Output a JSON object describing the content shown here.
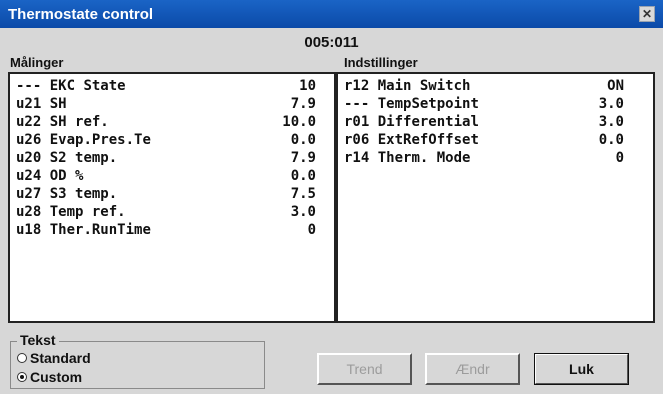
{
  "window": {
    "title": "Thermostate control",
    "close_label": "✕"
  },
  "header": {
    "code": "005:011"
  },
  "maalinger": {
    "label": "Målinger",
    "rows": [
      {
        "code": "---",
        "name": "EKC State",
        "value": "10"
      },
      {
        "code": "u21",
        "name": "SH",
        "value": "7.9"
      },
      {
        "code": "u22",
        "name": "SH ref.",
        "value": "10.0"
      },
      {
        "code": "u26",
        "name": "Evap.Pres.Te",
        "value": "0.0"
      },
      {
        "code": "u20",
        "name": "S2 temp.",
        "value": "7.9"
      },
      {
        "code": "u24",
        "name": "OD %",
        "value": "0.0"
      },
      {
        "code": "u27",
        "name": "S3 temp.",
        "value": "7.5"
      },
      {
        "code": "u28",
        "name": "Temp ref.",
        "value": "3.0"
      },
      {
        "code": "u18",
        "name": "Ther.RunTime",
        "value": "0"
      }
    ]
  },
  "indstillinger": {
    "label": "Indstillinger",
    "rows": [
      {
        "code": "r12",
        "name": "Main Switch",
        "value": "ON"
      },
      {
        "code": "---",
        "name": "TempSetpoint",
        "value": "3.0"
      },
      {
        "code": "r01",
        "name": "Differential",
        "value": "3.0"
      },
      {
        "code": "r06",
        "name": "ExtRefOffset",
        "value": "0.0"
      },
      {
        "code": "r14",
        "name": "Therm. Mode",
        "value": "0"
      }
    ]
  },
  "tekst": {
    "label": "Tekst",
    "options": [
      {
        "label": "Standard",
        "selected": false
      },
      {
        "label": "Custom",
        "selected": true
      }
    ]
  },
  "buttons": {
    "trend": "Trend",
    "aendr": "Ændr",
    "luk": "Luk"
  }
}
